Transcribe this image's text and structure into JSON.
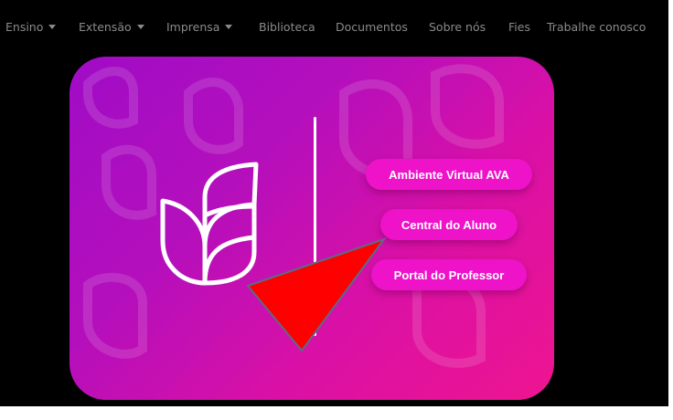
{
  "nav": {
    "items": [
      {
        "label": "Ensino",
        "dropdown": true
      },
      {
        "label": "Extensão",
        "dropdown": true
      },
      {
        "label": "Imprensa",
        "dropdown": true
      },
      {
        "label": "Biblioteca",
        "dropdown": false
      },
      {
        "label": "Documentos",
        "dropdown": false
      },
      {
        "label": "Sobre nós",
        "dropdown": false
      },
      {
        "label": "Fies",
        "dropdown": false
      },
      {
        "label": "Trabalhe conosco",
        "dropdown": false
      }
    ]
  },
  "hero": {
    "buttons": {
      "ava": "Ambiente Virtual AVA",
      "aluno": "Central do Aluno",
      "professor": "Portal do Professor"
    },
    "icons": [
      "leaf-logo-icon"
    ]
  },
  "colors": {
    "card_gradient_start": "#a00cc6",
    "card_gradient_end": "#ee1590",
    "button": "#ee12c9",
    "overlay_triangle": "#ff0000",
    "nav_text": "#8a8a8a"
  }
}
